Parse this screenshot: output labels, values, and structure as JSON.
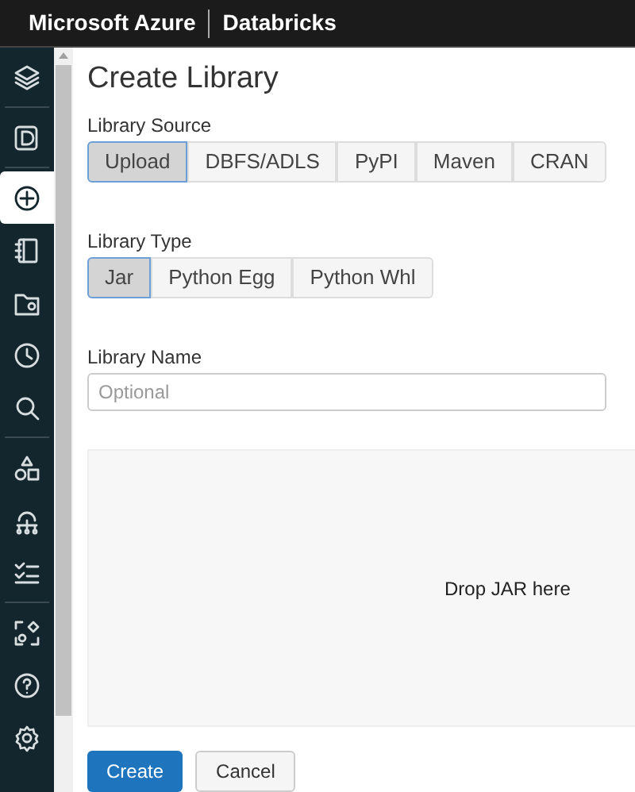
{
  "header": {
    "brand": "Microsoft Azure",
    "product": "Databricks"
  },
  "sidebar": {
    "groups": [
      [
        {
          "selected": false
        }
      ],
      [
        {
          "selected": false
        }
      ],
      [
        {
          "selected": true
        },
        {
          "selected": false
        },
        {
          "selected": false
        },
        {
          "selected": false
        },
        {
          "selected": false
        }
      ],
      [
        {
          "selected": false
        },
        {
          "selected": false
        },
        {
          "selected": false
        }
      ],
      [
        {
          "selected": false
        },
        {
          "selected": false
        },
        {
          "selected": false
        }
      ]
    ]
  },
  "title": "Create Library",
  "library_source": {
    "label": "Library Source",
    "options": [
      {
        "label": "Upload",
        "selected": true
      },
      {
        "label": "DBFS/ADLS",
        "selected": false
      },
      {
        "label": "PyPI",
        "selected": false
      },
      {
        "label": "Maven",
        "selected": false
      },
      {
        "label": "CRAN",
        "selected": false
      }
    ]
  },
  "library_type": {
    "label": "Library Type",
    "options": [
      {
        "label": "Jar",
        "selected": true
      },
      {
        "label": "Python Egg",
        "selected": false
      },
      {
        "label": "Python Whl",
        "selected": false
      }
    ]
  },
  "library_name": {
    "label": "Library Name",
    "placeholder": "Optional"
  },
  "drop_zone": {
    "text": "Drop JAR here"
  },
  "buttons": [
    {
      "label": "Create",
      "kind": "primary"
    },
    {
      "label": "Cancel",
      "kind": "secondary"
    }
  ]
}
